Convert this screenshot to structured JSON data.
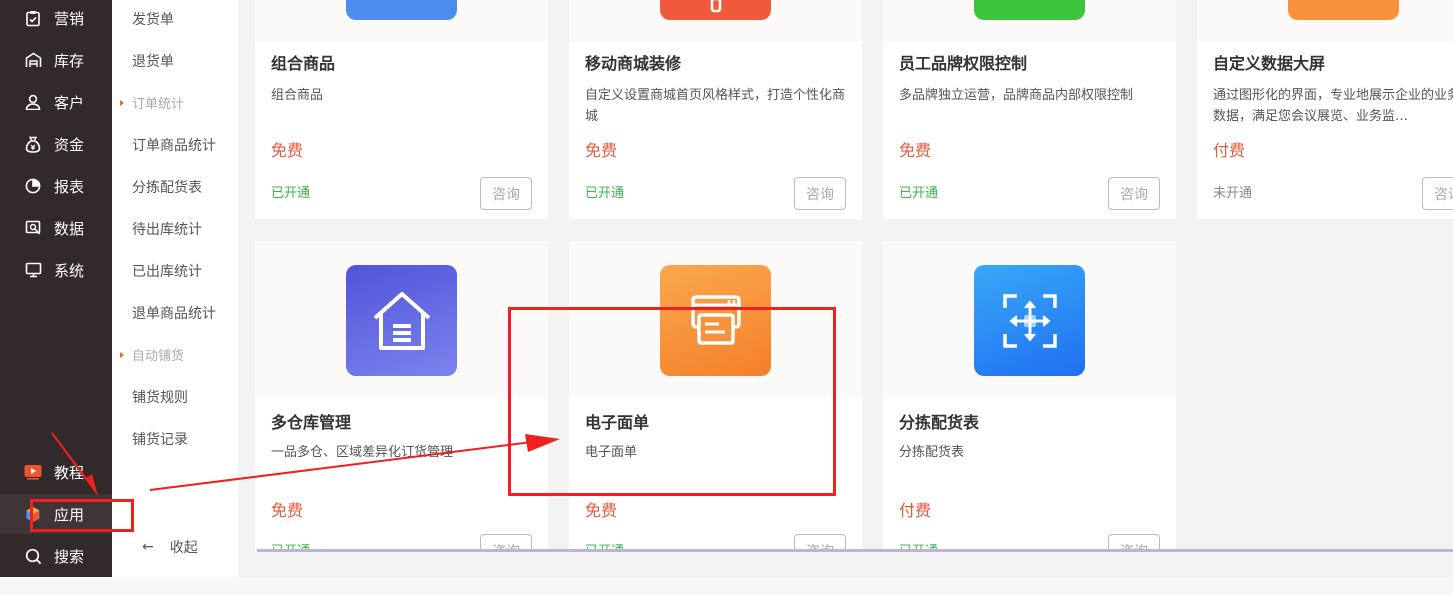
{
  "nav": {
    "items": [
      {
        "label": "营销",
        "icon": "clipboard-check-icon"
      },
      {
        "label": "库存",
        "icon": "warehouse-icon"
      },
      {
        "label": "客户",
        "icon": "user-icon"
      },
      {
        "label": "资金",
        "icon": "money-bag-icon"
      },
      {
        "label": "报表",
        "icon": "pie-chart-icon"
      },
      {
        "label": "数据",
        "icon": "data-search-icon"
      },
      {
        "label": "系统",
        "icon": "monitor-icon"
      }
    ],
    "bottom": [
      {
        "label": "教程",
        "icon": "video-play-icon"
      },
      {
        "label": "应用",
        "icon": "app-cube-icon"
      },
      {
        "label": "搜索",
        "icon": "search-icon"
      }
    ]
  },
  "subnav": {
    "items": [
      "发货单",
      "退货单"
    ],
    "group1": "订单统计",
    "group1_items": [
      "订单商品统计",
      "分拣配货表",
      "待出库统计",
      "已出库统计",
      "退单商品统计"
    ],
    "group2": "自动铺货",
    "group2_items": [
      "铺货规则",
      "铺货记录"
    ],
    "collapse_icon": "←",
    "collapse_label": "收起"
  },
  "cards_row1": [
    {
      "title": "组合商品",
      "desc": "组合商品",
      "price": "免费",
      "status": "已开通",
      "button": "咨询",
      "color": "#4b8ef0"
    },
    {
      "title": "移动商城装修",
      "desc": "自定义设置商城首页风格样式，打造个性化商城",
      "price": "免费",
      "status": "已开通",
      "button": "咨询",
      "color": "#f05a3c"
    },
    {
      "title": "员工品牌权限控制",
      "desc": "多品牌独立运营，品牌商品内部权限控制",
      "price": "免费",
      "status": "已开通",
      "button": "咨询",
      "color": "#3cc43c"
    },
    {
      "title": "自定义数据大屏",
      "desc": "通过图形化的界面，专业地展示企业的业务数据，满足您会议展览、业务监…",
      "price": "付费",
      "status": "未开通",
      "button": "咨询",
      "color": "#f7913a"
    }
  ],
  "cards_row2": [
    {
      "title": "多仓库管理",
      "desc": "一品多仓、区域差异化订货管理",
      "price": "免费",
      "status": "已开通",
      "button": "咨询",
      "icon": "warehouse-house-icon",
      "color": "#5b5fe0"
    },
    {
      "title": "电子面单",
      "desc": "电子面单",
      "price": "免费",
      "status": "已开通",
      "button": "咨询",
      "icon": "printer-icon",
      "color": "#f78a3a"
    },
    {
      "title": "分拣配货表",
      "desc": "分拣配货表",
      "price": "付费",
      "status": "已开通",
      "button": "咨询",
      "icon": "sort-arrows-icon",
      "color": "#2d8cf5"
    }
  ]
}
